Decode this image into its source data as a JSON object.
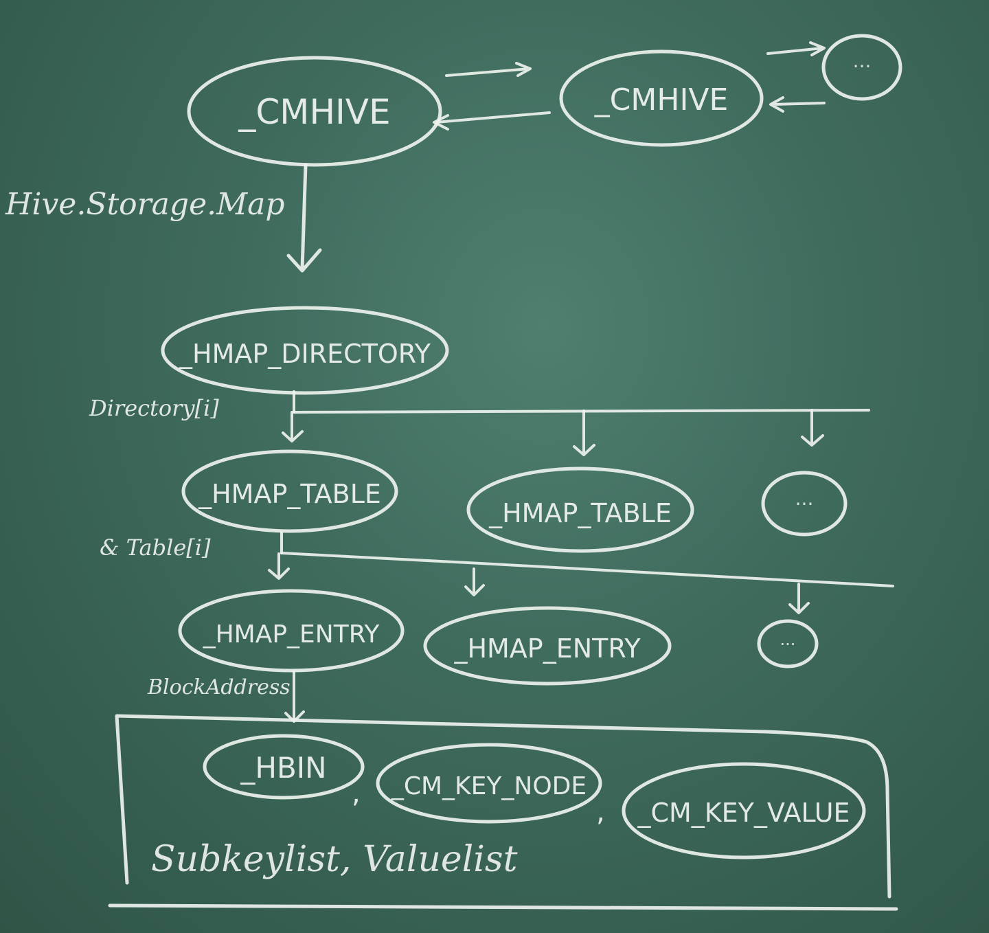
{
  "nodes": {
    "cmhive_1": "_CMHIVE",
    "cmhive_2": "_CMHIVE",
    "hmap_directory": "_HMAP_DIRECTORY",
    "hmap_table_1": "_HMAP_TABLE",
    "hmap_table_2": "_HMAP_TABLE",
    "hmap_entry_1": "_HMAP_ENTRY",
    "hmap_entry_2": "_HMAP_ENTRY",
    "hbin": "_HBIN",
    "cm_key_node": "_CM_KEY_NODE",
    "cm_key_value": "_CM_KEY_VALUE",
    "ellipsis": "..."
  },
  "labels": {
    "storage_map": "Hive.Storage.Map",
    "directory": "Directory[i]",
    "table": "& Table[i]",
    "block_address": "BlockAddress"
  },
  "block": {
    "comma": ",",
    "footer": "Subkeylist, Valuelist"
  }
}
